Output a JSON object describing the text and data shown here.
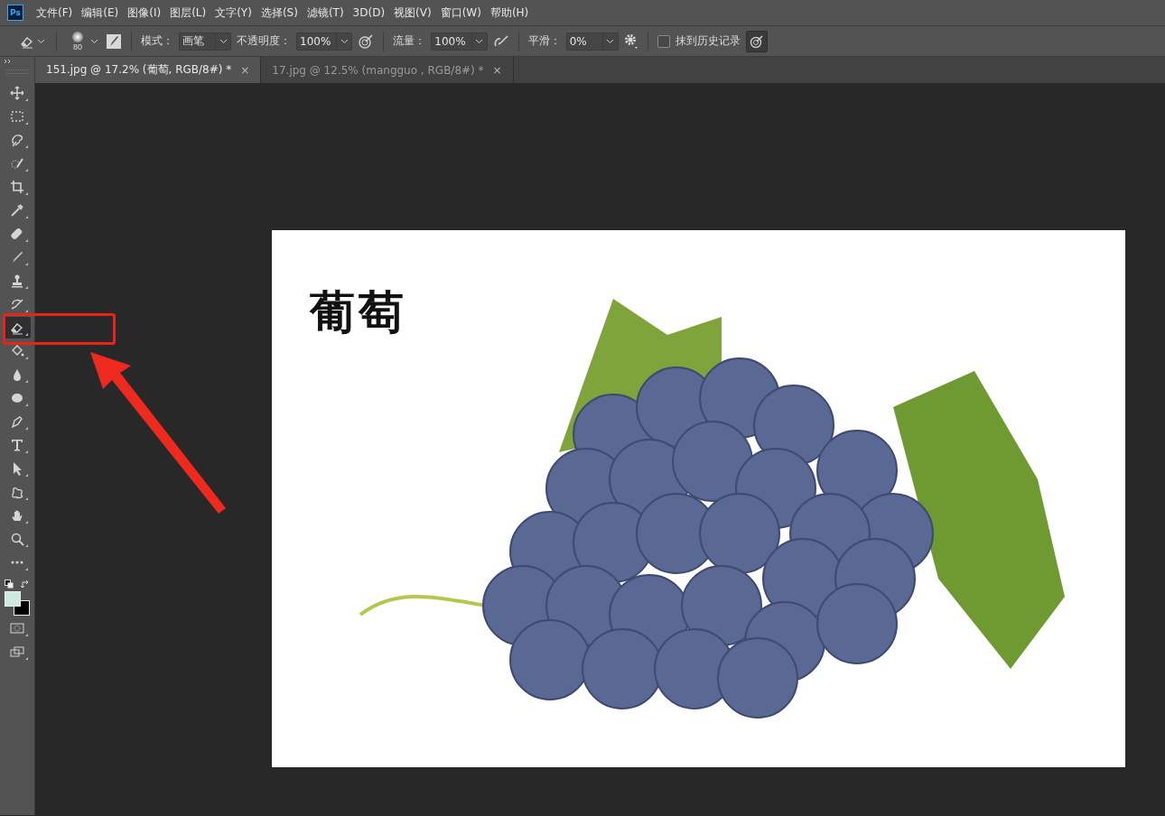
{
  "app": {
    "logo": "Ps"
  },
  "menu": [
    "文件(F)",
    "编辑(E)",
    "图像(I)",
    "图层(L)",
    "文字(Y)",
    "选择(S)",
    "滤镜(T)",
    "3D(D)",
    "视图(V)",
    "窗口(W)",
    "帮助(H)"
  ],
  "options": {
    "brush_size": "80",
    "mode": {
      "label": "模式：",
      "value": "画笔"
    },
    "opacity": {
      "label": "不透明度：",
      "value": "100%"
    },
    "flow": {
      "label": "流量：",
      "value": "100%"
    },
    "smoothing": {
      "label": "平滑：",
      "value": "0%"
    },
    "erase_to_history": {
      "label": "抹到历史记录",
      "checked": false
    }
  },
  "tabs": [
    {
      "title": "151.jpg @ 17.2% (葡萄, RGB/8#) *",
      "close": "×",
      "selected": true
    },
    {
      "title": "17.jpg @ 12.5% (mangguo , RGB/8#) *",
      "close": "×",
      "selected": false
    }
  ],
  "tools": [
    {
      "kind": "move",
      "selected": false
    },
    {
      "kind": "marquee",
      "selected": false
    },
    {
      "kind": "lasso",
      "selected": false
    },
    {
      "kind": "quick-select",
      "selected": false
    },
    {
      "kind": "crop",
      "selected": false
    },
    {
      "kind": "eyedropper",
      "selected": false
    },
    {
      "kind": "healing",
      "selected": false
    },
    {
      "kind": "brush",
      "selected": false
    },
    {
      "kind": "stamp",
      "selected": false
    },
    {
      "kind": "history-brush",
      "selected": false
    },
    {
      "kind": "eraser",
      "selected": true
    },
    {
      "kind": "bucket",
      "selected": false
    },
    {
      "kind": "blur",
      "selected": false
    },
    {
      "kind": "sponge",
      "selected": false
    },
    {
      "kind": "pen",
      "selected": false
    },
    {
      "kind": "type",
      "selected": false
    },
    {
      "kind": "path-select",
      "selected": false
    },
    {
      "kind": "shape",
      "selected": false
    },
    {
      "kind": "hand",
      "selected": false
    },
    {
      "kind": "zoom",
      "selected": false
    },
    {
      "kind": "more",
      "selected": false
    }
  ],
  "document": {
    "caption": "葡萄"
  }
}
